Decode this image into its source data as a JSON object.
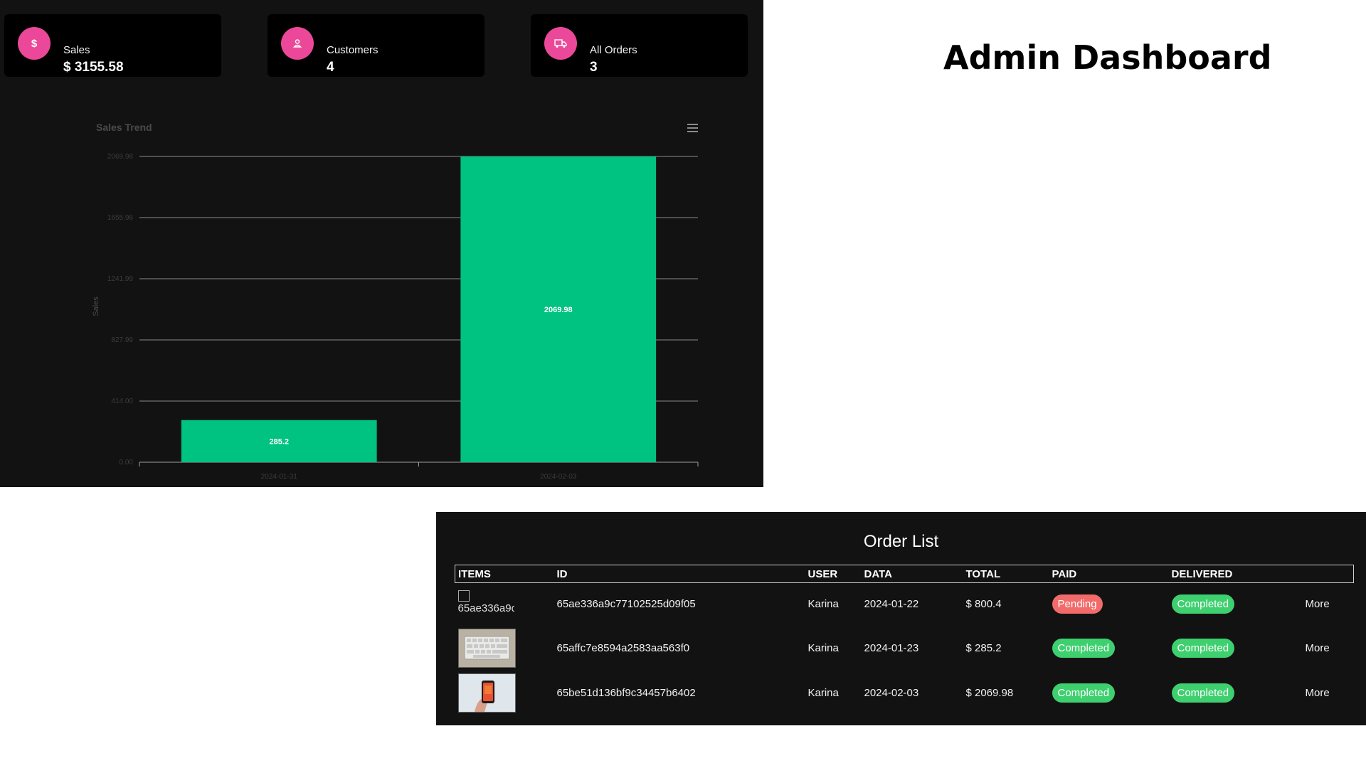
{
  "stats": [
    {
      "label": "Sales",
      "value": "$ 3155.58",
      "icon": "dollar-icon",
      "glyph": "$"
    },
    {
      "label": "Customers",
      "value": "4",
      "icon": "user-icon",
      "glyph": "👤"
    },
    {
      "label": "All Orders",
      "value": "3",
      "icon": "truck-icon",
      "glyph": "⛟"
    }
  ],
  "colors": {
    "accent": "#ec4899",
    "bar": "#00c281",
    "pending": "#f26b6b",
    "completed": "#3ecf6f"
  },
  "chart_data": {
    "type": "bar",
    "title": "Sales Trend",
    "ylabel": "Sales",
    "xlabel": "",
    "categories": [
      "2024-01-31",
      "2024-02-03"
    ],
    "values": [
      285.2,
      2069.98
    ],
    "data_labels": [
      "285.2",
      "2069.98"
    ],
    "y_ticks": [
      "0.00",
      "414.00",
      "827.99",
      "1241.99",
      "1655.98",
      "2069.98"
    ],
    "ylim": [
      0,
      2069.98
    ],
    "grid": true,
    "menu_icon": "hamburger-icon"
  },
  "admin_title": "Admin Dashboard",
  "orders": {
    "title": "Order List",
    "columns": [
      "ITEMS",
      "ID",
      "USER",
      "DATA",
      "TOTAL",
      "PAID",
      "DELIVERED",
      ""
    ],
    "rows": [
      {
        "item_alt": "65ae336a9c",
        "item_image": "broken-image",
        "id": "65ae336a9c77102525d09f05",
        "user": "Karina",
        "date": "2024-01-22",
        "total": "$ 800.4",
        "paid": "Pending",
        "delivered": "Completed",
        "action": "More"
      },
      {
        "item_alt": "",
        "item_image": "keyboard-image",
        "id": "65affc7e8594a2583aa563f0",
        "user": "Karina",
        "date": "2024-01-23",
        "total": "$ 285.2",
        "paid": "Completed",
        "delivered": "Completed",
        "action": "More"
      },
      {
        "item_alt": "",
        "item_image": "phone-image",
        "id": "65be51d136bf9c34457b6402",
        "user": "Karina",
        "date": "2024-02-03",
        "total": "$ 2069.98",
        "paid": "Completed",
        "delivered": "Completed",
        "action": "More"
      }
    ]
  }
}
